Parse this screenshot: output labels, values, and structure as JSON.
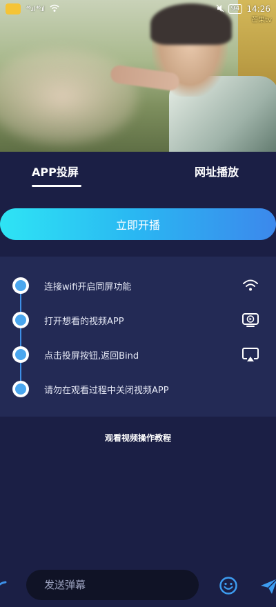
{
  "status_bar": {
    "signal_left": "⁴⁶.ıl ⁴⁶.ıl",
    "battery": "94",
    "time": "14:26",
    "watermark": "芒果tv"
  },
  "tabs": [
    {
      "label": "APP投屏",
      "active": true
    },
    {
      "label": "网址播放",
      "active": false
    }
  ],
  "start_button": {
    "label": "立即开播"
  },
  "steps": [
    {
      "text": "连接wifi开启同屏功能",
      "icon": "wifi-icon"
    },
    {
      "text": "打开想看的视频APP",
      "icon": "tv-play-icon"
    },
    {
      "text": "点击投屏按钮,返回Bind",
      "icon": "cast-icon"
    },
    {
      "text": "请勿在观看过程中关闭视频APP",
      "icon": ""
    }
  ],
  "tutorial_link": "观看视频操作教程",
  "bottom_bar": {
    "input_placeholder": "发送弹幕"
  },
  "colors": {
    "background": "#1b1f45",
    "panel": "#232a55",
    "accent_start": "#2ee4f4",
    "accent_end": "#3c88ec",
    "dot": "#4aa6ee"
  }
}
